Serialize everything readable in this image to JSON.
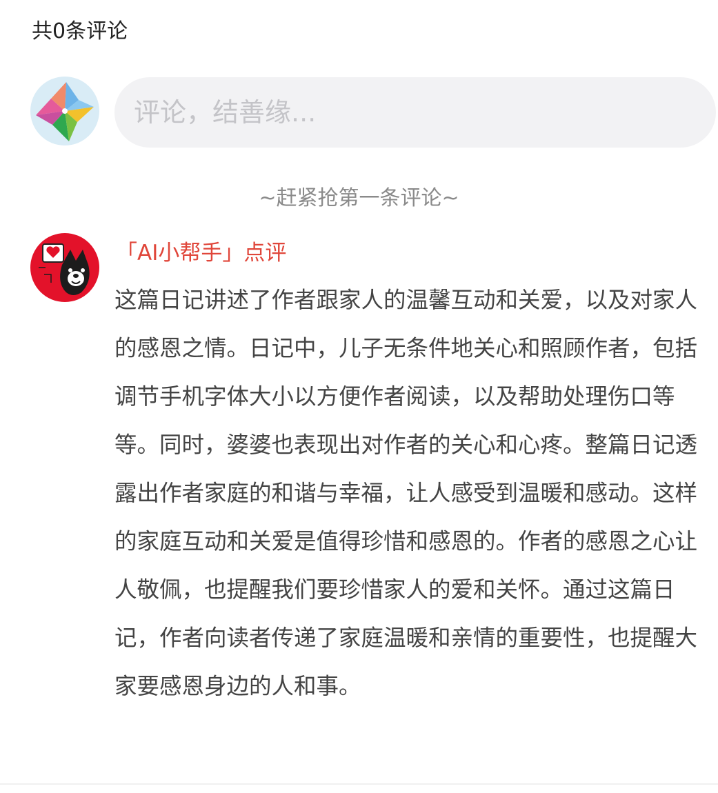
{
  "comments": {
    "count_label": "共0条评论",
    "input_placeholder": "评论，结善缘...",
    "empty_hint": "~赶紧抢第一条评论~"
  },
  "ai_review": {
    "title": "「AI小帮手」点评",
    "body": "这篇日记讲述了作者跟家人的温馨互动和关爱，以及对家人的感恩之情。日记中，儿子无条件地关心和照顾作者，包括调节手机字体大小以方便作者阅读，以及帮助处理伤口等等。同时，婆婆也表现出对作者的关心和心疼。整篇日记透露出作者家庭的和谐与幸福，让人感受到温暖和感动。这样的家庭互动和关爱是值得珍惜和感恩的。作者的感恩之心让人敬佩，也提醒我们要珍惜家人的爱和关怀。通过这篇日记，作者向读者传递了家庭温暖和亲情的重要性，也提醒大家要感恩身边的人和事。"
  },
  "icons": {
    "user_avatar": "pinwheel-avatar-icon",
    "ai_avatar": "ai-helper-dog-avatar-icon"
  },
  "colors": {
    "accent": "#e0463a",
    "input_bg": "#f2f2f4",
    "placeholder": "#c4c4c8",
    "hint": "#8a8a8a",
    "body_text": "#444444"
  }
}
